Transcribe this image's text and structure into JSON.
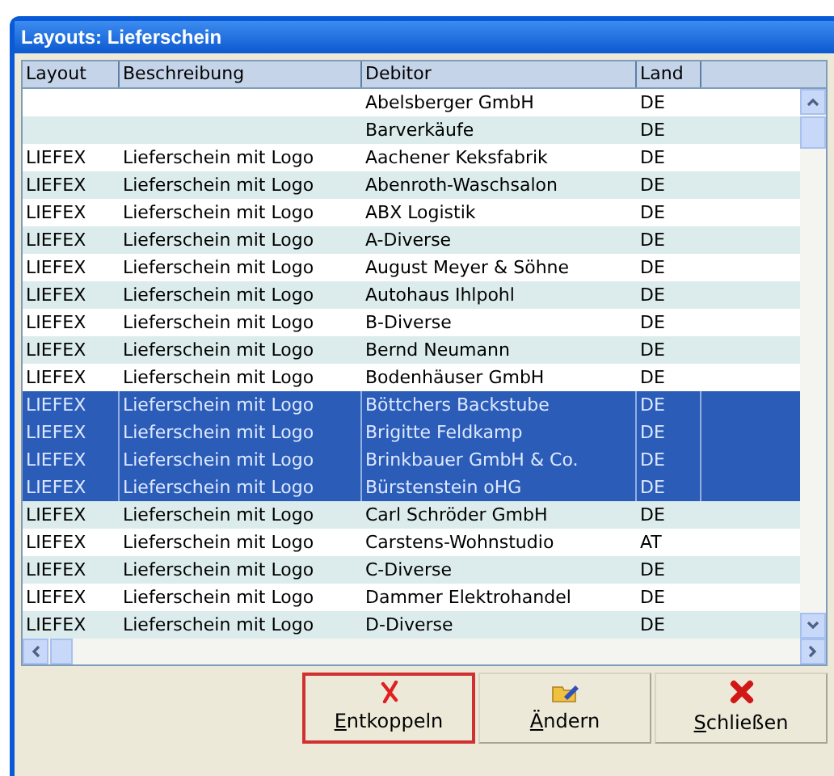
{
  "window": {
    "title": "Layouts: Lieferschein"
  },
  "table": {
    "columns": [
      "Layout",
      "Beschreibung",
      "Debitor",
      "Land"
    ],
    "rows": [
      {
        "cells": [
          "",
          "",
          "Abelsberger GmbH",
          "DE"
        ],
        "selected": false
      },
      {
        "cells": [
          "",
          "",
          "Barverkäufe",
          "DE"
        ],
        "selected": false
      },
      {
        "cells": [
          "LIEFEX",
          "Lieferschein mit Logo",
          "Aachener Keksfabrik",
          "DE"
        ],
        "selected": false
      },
      {
        "cells": [
          "LIEFEX",
          "Lieferschein mit Logo",
          "Abenroth-Waschsalon",
          "DE"
        ],
        "selected": false
      },
      {
        "cells": [
          "LIEFEX",
          "Lieferschein mit Logo",
          "ABX Logistik",
          "DE"
        ],
        "selected": false
      },
      {
        "cells": [
          "LIEFEX",
          "Lieferschein mit Logo",
          "A-Diverse",
          "DE"
        ],
        "selected": false
      },
      {
        "cells": [
          "LIEFEX",
          "Lieferschein mit Logo",
          "August Meyer & Söhne",
          "DE"
        ],
        "selected": false
      },
      {
        "cells": [
          "LIEFEX",
          "Lieferschein mit Logo",
          "Autohaus Ihlpohl",
          "DE"
        ],
        "selected": false
      },
      {
        "cells": [
          "LIEFEX",
          "Lieferschein mit Logo",
          "B-Diverse",
          "DE"
        ],
        "selected": false
      },
      {
        "cells": [
          "LIEFEX",
          "Lieferschein mit Logo",
          "Bernd Neumann",
          "DE"
        ],
        "selected": false
      },
      {
        "cells": [
          "LIEFEX",
          "Lieferschein mit Logo",
          "Bodenhäuser GmbH",
          "DE"
        ],
        "selected": false
      },
      {
        "cells": [
          "LIEFEX",
          "Lieferschein mit Logo",
          "Böttchers Backstube",
          "DE"
        ],
        "selected": true
      },
      {
        "cells": [
          "LIEFEX",
          "Lieferschein mit Logo",
          "Brigitte Feldkamp",
          "DE"
        ],
        "selected": true
      },
      {
        "cells": [
          "LIEFEX",
          "Lieferschein mit Logo",
          "Brinkbauer GmbH & Co.",
          "DE"
        ],
        "selected": true
      },
      {
        "cells": [
          "LIEFEX",
          "Lieferschein mit Logo",
          "Bürstenstein oHG",
          "DE"
        ],
        "selected": true
      },
      {
        "cells": [
          "LIEFEX",
          "Lieferschein mit Logo",
          "Carl Schröder GmbH",
          "DE"
        ],
        "selected": false
      },
      {
        "cells": [
          "LIEFEX",
          "Lieferschein mit Logo",
          "Carstens-Wohnstudio",
          "AT"
        ],
        "selected": false
      },
      {
        "cells": [
          "LIEFEX",
          "Lieferschein mit Logo",
          "C-Diverse",
          "DE"
        ],
        "selected": false
      },
      {
        "cells": [
          "LIEFEX",
          "Lieferschein mit Logo",
          "Dammer Elektrohandel",
          "DE"
        ],
        "selected": false
      },
      {
        "cells": [
          "LIEFEX",
          "Lieferschein mit Logo",
          "D-Diverse",
          "DE"
        ],
        "selected": false
      }
    ]
  },
  "buttons": [
    {
      "label": "Entkoppeln",
      "kind": "unlink",
      "focused": true
    },
    {
      "label": "Ändern",
      "kind": "edit",
      "focused": false
    },
    {
      "label": "Schließen",
      "kind": "close",
      "focused": false
    }
  ]
}
